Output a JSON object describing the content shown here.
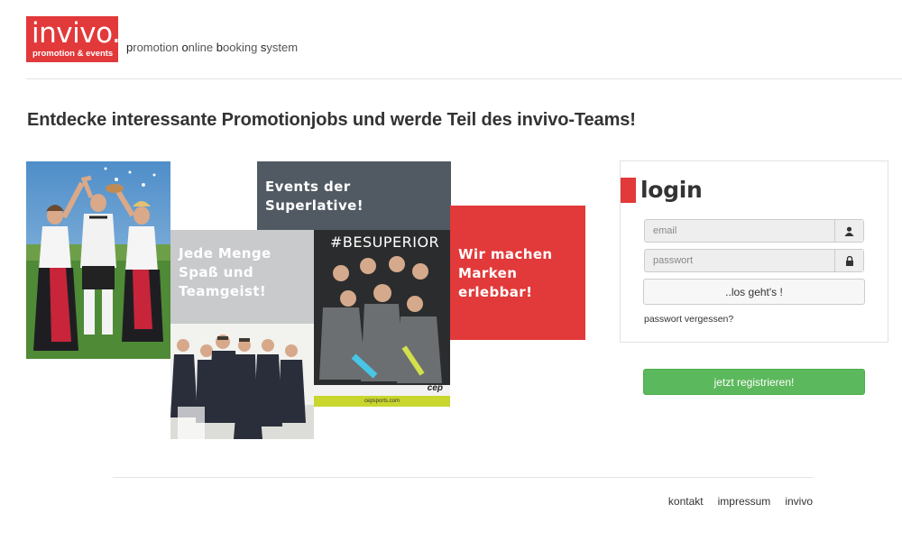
{
  "header": {
    "logo_main": "invivo.",
    "logo_sub": "promotion & events",
    "tagline": [
      {
        "bold": "p",
        "rest": "romotion "
      },
      {
        "bold": "o",
        "rest": "nline "
      },
      {
        "bold": "b",
        "rest": "ooking "
      },
      {
        "bold": "s",
        "rest": "ystem"
      }
    ]
  },
  "headline": "Entdecke interessante Promotionjobs und werde Teil des invivo-Teams!",
  "tiles": {
    "events": "Events der Superlative!",
    "spass": "Jede Menge Spaß und Teamgeist!",
    "marken": "Wir machen Marken erlebbar!",
    "besuperior": "#BESUPERIOR",
    "cep_logo": "cep",
    "cep_url": "cepsports.com"
  },
  "login": {
    "title": "login",
    "email_placeholder": "email",
    "password_placeholder": "passwort",
    "submit_label": "..los geht's !",
    "forgot_label": "passwort vergessen?"
  },
  "register_label": "jetzt registrieren!",
  "footer": {
    "links": [
      "kontakt",
      "impressum",
      "invivo"
    ]
  },
  "colors": {
    "brand_red": "#e2393a",
    "slate": "#515a63",
    "light_gray": "#c8cacc",
    "success_green": "#5cb85c"
  },
  "icons": {
    "email": "user-icon",
    "password": "lock-icon"
  }
}
